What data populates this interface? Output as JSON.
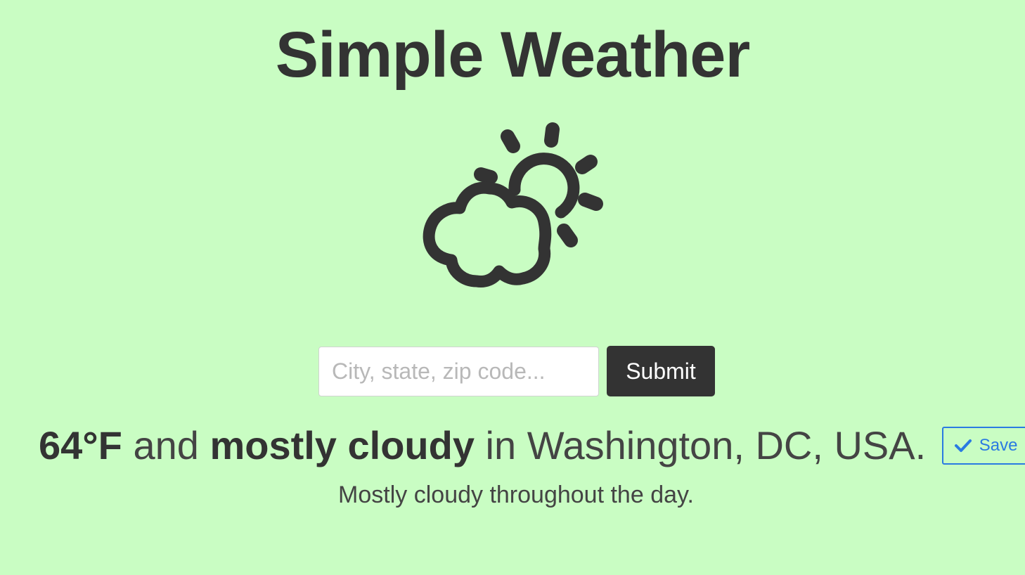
{
  "app": {
    "title": "Simple Weather"
  },
  "icon": {
    "name": "partly-cloudy-icon",
    "color": "#333333"
  },
  "search": {
    "placeholder": "City, state, zip code...",
    "value": "",
    "submit_label": "Submit"
  },
  "weather": {
    "temperature": "64°F",
    "connector_and": " and ",
    "condition": "mostly cloudy",
    "connector_in": " in ",
    "location": "Washington, DC, USA.",
    "description": "Mostly cloudy throughout the day."
  },
  "save": {
    "label": "Save",
    "icon": "checkmark-icon"
  },
  "colors": {
    "background": "#c9fdc3",
    "text": "#333333",
    "accent": "#2a7ae2",
    "button_dark": "#333333"
  }
}
